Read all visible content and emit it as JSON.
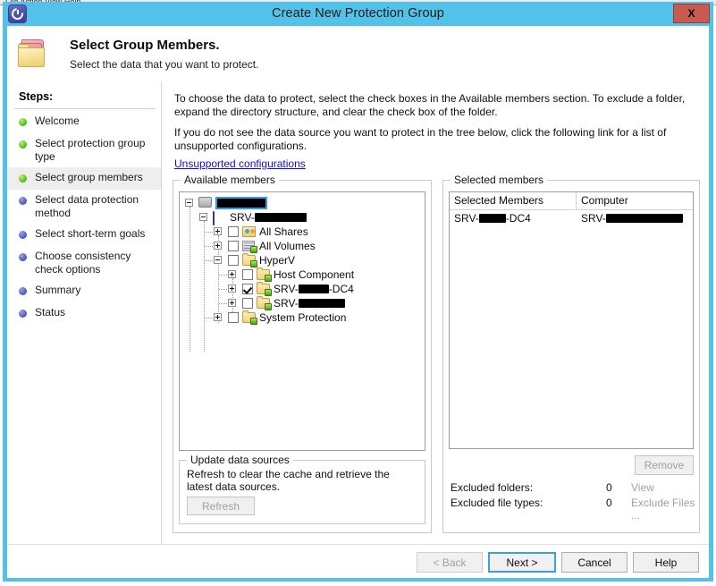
{
  "window": {
    "title": "Create New Protection Group",
    "app_icon": "dpm-clock-icon",
    "close_label": "X",
    "frame_color": "#53c2e8",
    "titlebar_color": "#53c2e8",
    "close_button_color": "#c75b52"
  },
  "header": {
    "icon": "folders-icon",
    "title": "Select Group Members.",
    "subtitle": "Select the data that you want to protect."
  },
  "sidebar": {
    "heading": "Steps:",
    "items": [
      {
        "label": "Welcome",
        "state": "done"
      },
      {
        "label": "Select protection group type",
        "state": "done"
      },
      {
        "label": "Select group members",
        "state": "current"
      },
      {
        "label": "Select data protection method",
        "state": "pending"
      },
      {
        "label": "Select short-term goals",
        "state": "pending"
      },
      {
        "label": "Choose consistency check options",
        "state": "pending"
      },
      {
        "label": "Summary",
        "state": "pending"
      },
      {
        "label": "Status",
        "state": "pending"
      }
    ],
    "bullet_done_color": "#62c81e",
    "bullet_pending_color": "#5a64c8"
  },
  "content": {
    "paragraph_1": "To choose the data to protect, select the check boxes in the Available members section. To exclude a folder, expand the directory structure, and clear the check box of the folder.",
    "paragraph_2": "If you do not see the data source you want to protect in the tree below, click the following link for a list of unsupported configurations.",
    "link_label": "Unsupported configurations",
    "link_color": "#1111cc"
  },
  "available_members": {
    "legend": "Available members",
    "tree": [
      {
        "label": "",
        "redacted": true,
        "redact_width": 56,
        "icon": "server-group-icon",
        "expander": "minus",
        "checkbox": "none",
        "selected": true,
        "indent": 0
      },
      {
        "label": "SRV-",
        "redacted": true,
        "redact_width": 58,
        "icon": "dpm-server-icon",
        "expander": "minus",
        "checkbox": "none",
        "selected": false,
        "indent": 1
      },
      {
        "label": "All Shares",
        "redacted": false,
        "icon": "shares-icon",
        "expander": "plus",
        "checkbox": "unchecked",
        "selected": false,
        "indent": 2
      },
      {
        "label": "All Volumes",
        "redacted": false,
        "icon": "volumes-icon",
        "expander": "plus",
        "checkbox": "unchecked",
        "selected": false,
        "indent": 2
      },
      {
        "label": "HyperV",
        "redacted": false,
        "icon": "folder-green-icon",
        "expander": "minus",
        "checkbox": "unchecked",
        "selected": false,
        "indent": 2
      },
      {
        "label": "Host Component",
        "redacted": false,
        "icon": "folder-green-icon",
        "expander": "plus",
        "checkbox": "unchecked",
        "selected": false,
        "indent": 3
      },
      {
        "label": "SRV-",
        "label_suffix": "-DC4",
        "redacted": true,
        "redact_width": 34,
        "icon": "folder-green-icon",
        "expander": "plus",
        "checkbox": "checked",
        "selected": false,
        "indent": 3
      },
      {
        "label": "SRV-",
        "redacted": true,
        "redact_width": 52,
        "icon": "folder-green-icon",
        "expander": "plus",
        "checkbox": "unchecked",
        "selected": false,
        "indent": 3
      },
      {
        "label": "System Protection",
        "redacted": false,
        "icon": "folder-green-icon",
        "expander": "plus",
        "checkbox": "unchecked",
        "selected": false,
        "indent": 2
      }
    ]
  },
  "update_data_sources": {
    "legend": "Update data sources",
    "description": "Refresh to clear the cache and retrieve the latest data sources.",
    "refresh_label": "Refresh",
    "refresh_enabled": false
  },
  "selected_members": {
    "legend": "Selected members",
    "columns": [
      "Selected Members",
      "Computer"
    ],
    "rows": [
      {
        "member_prefix": "SRV-",
        "member_redact_width": 30,
        "member_suffix": "-DC4",
        "computer_prefix": "SRV-",
        "computer_redact_width": 86
      }
    ],
    "remove_label": "Remove",
    "remove_enabled": false,
    "excluded_folders_label": "Excluded folders:",
    "excluded_folders_count": "0",
    "excluded_folders_action": "View",
    "excluded_file_types_label": "Excluded file types:",
    "excluded_file_types_count": "0",
    "excluded_file_types_action": "Exclude Files ..."
  },
  "footer": {
    "back_label": "< Back",
    "back_enabled": false,
    "next_label": "Next >",
    "next_is_default": true,
    "cancel_label": "Cancel",
    "help_label": "Help"
  }
}
